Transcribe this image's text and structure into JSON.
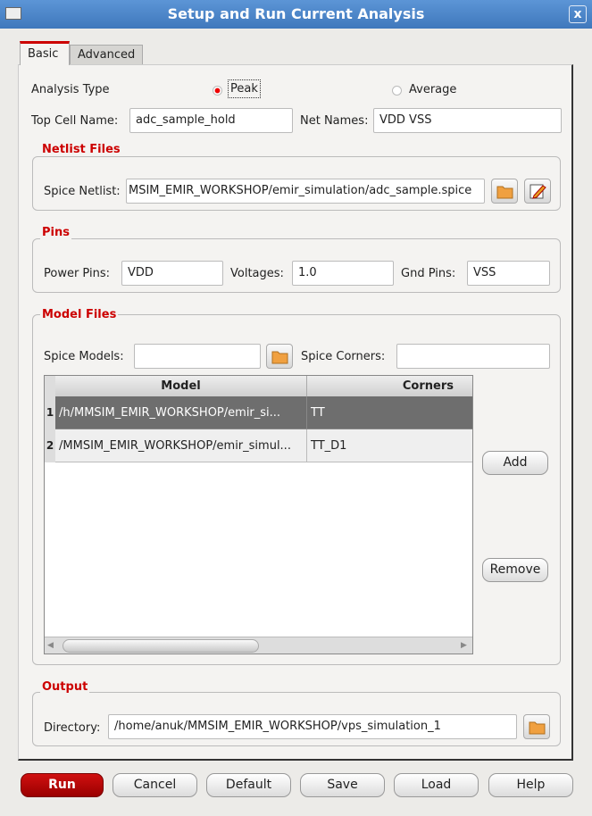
{
  "window": {
    "title": "Setup and Run Current Analysis",
    "close": "x"
  },
  "tabs": [
    {
      "label": "Basic",
      "active": true
    },
    {
      "label": "Advanced",
      "active": false
    }
  ],
  "analysis": {
    "label": "Analysis Type",
    "options": [
      "Peak",
      "Average"
    ],
    "selected": "Peak"
  },
  "top_cell": {
    "label": "Top Cell Name:",
    "value": "adc_sample_hold"
  },
  "net_names": {
    "label": "Net Names:",
    "value": "VDD VSS"
  },
  "netlist": {
    "title": "Netlist Files",
    "spice_label": "Spice Netlist:",
    "spice_value": "MSIM_EMIR_WORKSHOP/emir_simulation/adc_sample.spice"
  },
  "pins": {
    "title": "Pins",
    "power_label": "Power Pins:",
    "power_value": "VDD",
    "volt_label": "Voltages:",
    "volt_value": "1.0",
    "gnd_label": "Gnd Pins:",
    "gnd_value": "VSS"
  },
  "models": {
    "title": "Model Files",
    "spice_models_label": "Spice Models:",
    "spice_models_value": "",
    "corners_label": "Spice Corners:",
    "corners_value": "",
    "columns": [
      "Model",
      "Corners"
    ],
    "rows": [
      {
        "num": "1",
        "model": "/h/MMSIM_EMIR_WORKSHOP/emir_si...",
        "corner": "TT",
        "selected": true
      },
      {
        "num": "2",
        "model": "/MMSIM_EMIR_WORKSHOP/emir_simul...",
        "corner": "TT_D1",
        "selected": false
      }
    ],
    "add": "Add",
    "remove": "Remove"
  },
  "output": {
    "title": "Output",
    "dir_label": "Directory:",
    "dir_value": "/home/anuk/MMSIM_EMIR_WORKSHOP/vps_simulation_1"
  },
  "buttons": {
    "run": "Run",
    "cancel": "Cancel",
    "default": "Default",
    "save": "Save",
    "load": "Load",
    "help": "Help"
  },
  "colors": {
    "accent": "#cc0000",
    "titlebar": "#4a86c8",
    "selected_row": "#6e6e6e"
  }
}
